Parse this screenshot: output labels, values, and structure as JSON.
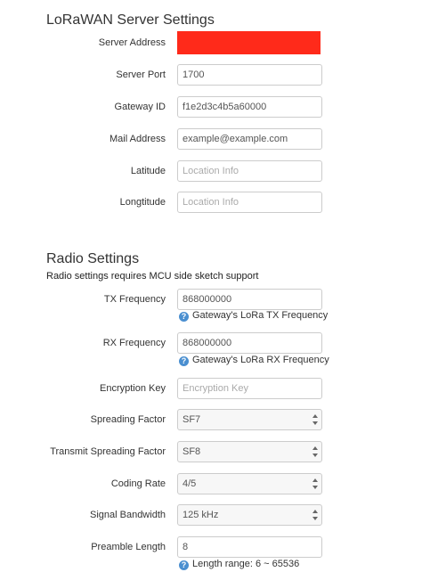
{
  "lorawan": {
    "title": "LoRaWAN Server Settings",
    "server_address": {
      "label": "Server Address",
      "value": ""
    },
    "server_port": {
      "label": "Server Port",
      "value": "1700"
    },
    "gateway_id": {
      "label": "Gateway ID",
      "value": "f1e2d3c4b5a60000"
    },
    "mail_address": {
      "label": "Mail Address",
      "value": "example@example.com"
    },
    "latitude": {
      "label": "Latitude",
      "placeholder": "Location Info"
    },
    "longitude": {
      "label": "Longtitude",
      "placeholder": "Location Info"
    }
  },
  "radio": {
    "title": "Radio Settings",
    "description": "Radio settings requires MCU side sketch support",
    "tx_frequency": {
      "label": "TX Frequency",
      "value": "868000000",
      "hint": "Gateway's LoRa TX Frequency"
    },
    "rx_frequency": {
      "label": "RX Frequency",
      "value": "868000000",
      "hint": "Gateway's LoRa RX Frequency"
    },
    "encryption_key": {
      "label": "Encryption Key",
      "placeholder": "Encryption Key"
    },
    "spreading_factor": {
      "label": "Spreading Factor",
      "value": "SF7"
    },
    "transmit_spreading_factor": {
      "label": "Transmit Spreading Factor",
      "value": "SF8"
    },
    "coding_rate": {
      "label": "Coding Rate",
      "value": "4/5"
    },
    "signal_bandwidth": {
      "label": "Signal Bandwidth",
      "value": "125 kHz"
    },
    "preamble_length": {
      "label": "Preamble Length",
      "value": "8",
      "hint": "Length range: 6 ~ 65536"
    }
  },
  "colors": {
    "redaction": "#ff2a1a",
    "help_icon": "#4a8fd0",
    "border": "#cccccc"
  },
  "icons": {
    "help": "help-icon",
    "select_arrows": "select-arrows-icon"
  }
}
